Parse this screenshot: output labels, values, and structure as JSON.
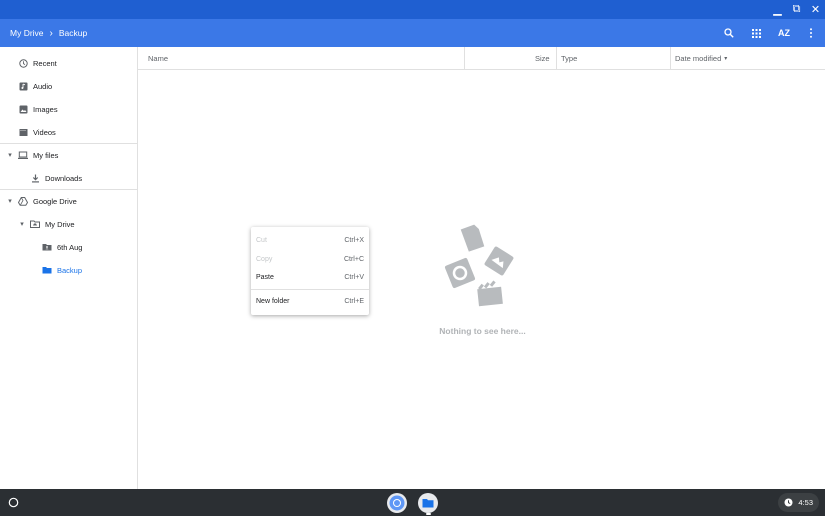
{
  "window": {
    "minimize_glyph": "▁",
    "maximize_glyph": "⧉",
    "close_glyph": "✕"
  },
  "header": {
    "breadcrumbs": [
      "My Drive",
      "Backup"
    ],
    "sort_label": "AZ"
  },
  "sidebar": {
    "items": [
      {
        "label": "Recent",
        "icon": "clock-icon"
      },
      {
        "label": "Audio",
        "icon": "audio-icon"
      },
      {
        "label": "Images",
        "icon": "image-icon"
      },
      {
        "label": "Videos",
        "icon": "video-icon"
      },
      {
        "label": "My files",
        "icon": "laptop-icon"
      },
      {
        "label": "Downloads",
        "icon": "download-icon"
      },
      {
        "label": "Google Drive",
        "icon": "drive-icon"
      },
      {
        "label": "My Drive",
        "icon": "drive-folder-icon"
      },
      {
        "label": "6th Aug",
        "icon": "shared-folder-icon"
      },
      {
        "label": "Backup",
        "icon": "folder-icon"
      }
    ]
  },
  "columns": {
    "name": "Name",
    "size": "Size",
    "type": "Type",
    "date": "Date modified"
  },
  "context_menu": {
    "items": [
      {
        "label": "Cut",
        "shortcut": "Ctrl+X",
        "enabled": false
      },
      {
        "label": "Copy",
        "shortcut": "Ctrl+C",
        "enabled": false
      },
      {
        "label": "Paste",
        "shortcut": "Ctrl+V",
        "enabled": true
      },
      {
        "label": "New folder",
        "shortcut": "Ctrl+E",
        "enabled": true
      }
    ]
  },
  "empty_state": {
    "text": "Nothing to see here..."
  },
  "shelf": {
    "time": "4:53"
  },
  "colors": {
    "titlebar": "#1f5fd1",
    "header": "#3b78e7",
    "accent": "#1a73e8",
    "shelf": "#2b2f33"
  }
}
